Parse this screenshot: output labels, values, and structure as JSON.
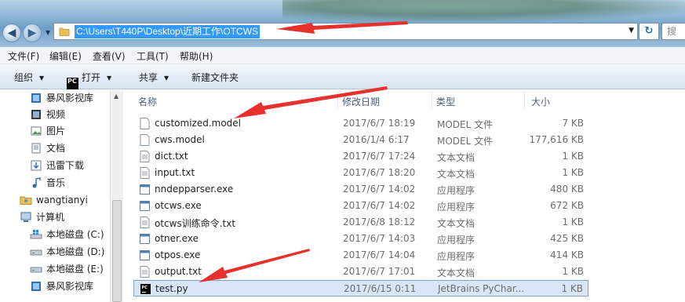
{
  "address": {
    "path": "C:\\Users\\T440P\\Desktop\\近期工作\\OTCWS",
    "search_placeholder": "搜"
  },
  "menu": [
    "文件(F)",
    "编辑(E)",
    "查看(V)",
    "工具(T)",
    "帮助(H)"
  ],
  "toolbar": {
    "organize": "组织",
    "open": "打开",
    "share": "共享",
    "new_folder": "新建文件夹"
  },
  "nav": [
    {
      "label": "暴风影视库",
      "icon": "video-library-icon"
    },
    {
      "label": "视频",
      "icon": "video-icon"
    },
    {
      "label": "图片",
      "icon": "pictures-icon"
    },
    {
      "label": "文档",
      "icon": "documents-icon"
    },
    {
      "label": "迅雷下载",
      "icon": "download-icon"
    },
    {
      "label": "音乐",
      "icon": "music-icon"
    },
    {
      "label": "wangtianyi",
      "icon": "user-folder-icon"
    },
    {
      "label": "计算机",
      "icon": "computer-icon"
    },
    {
      "label": "本地磁盘 (C:)",
      "icon": "system-drive-icon"
    },
    {
      "label": "本地磁盘 (D:)",
      "icon": "drive-icon"
    },
    {
      "label": "本地磁盘 (E:)",
      "icon": "drive-icon"
    },
    {
      "label": "暴风影视库",
      "icon": "video-library-icon"
    }
  ],
  "columns": {
    "name": "名称",
    "date": "修改日期",
    "type": "类型",
    "size": "大小"
  },
  "files": [
    {
      "name": "customized.model",
      "date": "2017/6/7 18:19",
      "type": "MODEL 文件",
      "size": "7 KB",
      "icon": "file-icon"
    },
    {
      "name": "cws.model",
      "date": "2016/1/4 6:17",
      "type": "MODEL 文件",
      "size": "177,616 KB",
      "icon": "file-icon"
    },
    {
      "name": "dict.txt",
      "date": "2017/6/7 17:24",
      "type": "文本文档",
      "size": "1 KB",
      "icon": "text-file-icon"
    },
    {
      "name": "input.txt",
      "date": "2017/6/7 18:20",
      "type": "文本文档",
      "size": "1 KB",
      "icon": "text-file-icon"
    },
    {
      "name": "nndepparser.exe",
      "date": "2017/6/7 14:02",
      "type": "应用程序",
      "size": "480 KB",
      "icon": "exe-icon"
    },
    {
      "name": "otcws.exe",
      "date": "2017/6/7 14:02",
      "type": "应用程序",
      "size": "672 KB",
      "icon": "exe-icon"
    },
    {
      "name": "otcws训练命令.txt",
      "date": "2017/6/8 18:12",
      "type": "文本文档",
      "size": "1 KB",
      "icon": "text-file-icon"
    },
    {
      "name": "otner.exe",
      "date": "2017/6/7 14:03",
      "type": "应用程序",
      "size": "425 KB",
      "icon": "exe-icon"
    },
    {
      "name": "otpos.exe",
      "date": "2017/6/7 14:04",
      "type": "应用程序",
      "size": "414 KB",
      "icon": "exe-icon"
    },
    {
      "name": "output.txt",
      "date": "2017/6/7 17:01",
      "type": "文本文档",
      "size": "1 KB",
      "icon": "text-file-icon"
    },
    {
      "name": "test.py",
      "date": "2017/6/15 0:11",
      "type": "JetBrains PyChar...",
      "size": "1 KB",
      "icon": "pycharm-icon",
      "selected": true
    }
  ],
  "colors": {
    "selection": "#3399ff",
    "annotation_arrow": "#e8302c",
    "row_selected": "#d8e6f5"
  }
}
